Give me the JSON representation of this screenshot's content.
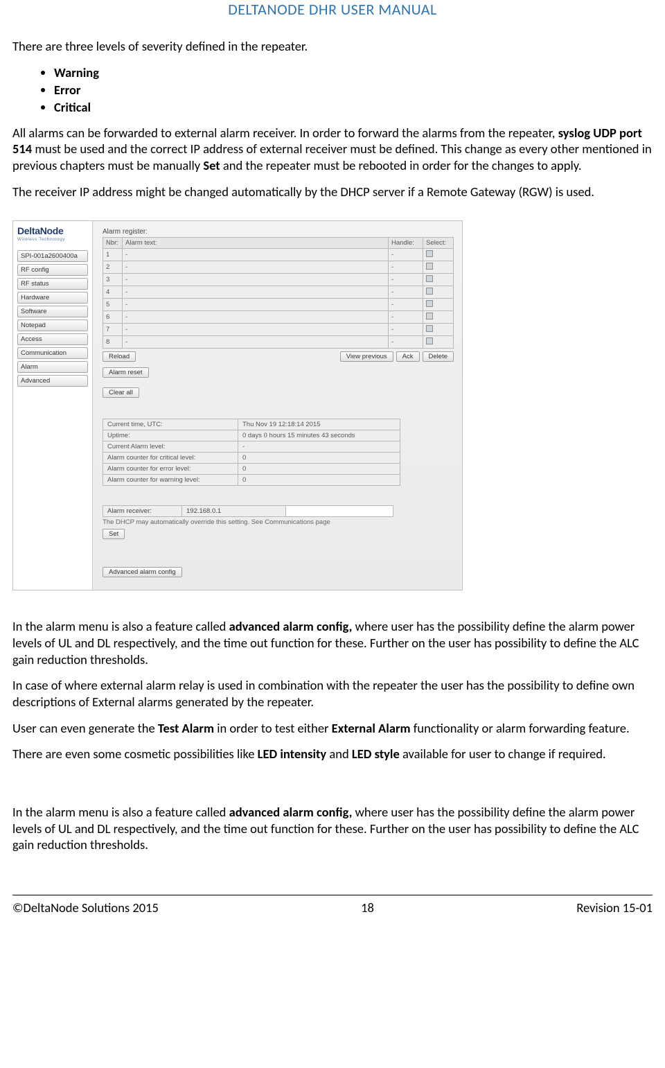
{
  "doc": {
    "title": "DELTANODE DHR USER MANUAL",
    "intro": "There are three levels of severity defined in the repeater.",
    "severities": [
      "Warning",
      "Error",
      "Critical"
    ],
    "p1_a": "All alarms can be forwarded to external alarm receiver. In order to forward the alarms from the repeater, ",
    "p1_bold1": "syslog UDP port 514",
    "p1_b": " must be used and the correct IP address of external receiver must be defined. This change as every other mentioned in previous chapters must be manually ",
    "p1_bold2": "Set",
    "p1_c": " and the repeater must be rebooted in order for the changes to apply.",
    "p2": "The receiver IP address might be changed automatically by the DHCP server if a Remote Gateway (RGW) is used.",
    "p3_a": "In the alarm menu is also a feature called ",
    "p3_bold1": "advanced alarm config,",
    "p3_b": " where user has the possibility define the alarm power levels of UL and DL respectively, and the time out function for these. Further on the user has possibility to define the ALC gain reduction thresholds.",
    "p4": "In case of where external alarm relay is used in combination with the repeater the user has the possibility to define own descriptions of External alarms generated by the repeater.",
    "p5_a": "User can even generate the ",
    "p5_bold1": "Test Alarm",
    "p5_b": " in order to test either ",
    "p5_bold2": "External Alarm",
    "p5_c": " functionality or alarm forwarding feature.",
    "p6_a": "There are even some cosmetic possibilities like ",
    "p6_bold1": "LED intensity",
    "p6_b": " and ",
    "p6_bold2": "LED style",
    "p6_c": " available for user to change if required.",
    "p7_a": "In the alarm menu is also a feature called ",
    "p7_bold1": "advanced alarm config,",
    "p7_b": " where user has the possibility define the alarm power levels of UL and DL respectively, and the time out function for these. Further on the user has possibility to define the ALC gain reduction thresholds.",
    "footer_left": "©DeltaNode Solutions 2015",
    "footer_center": "18",
    "footer_right": "Revision 15-01"
  },
  "app": {
    "logo": "DeltaNode",
    "logo_sub": "Wireless  Technology",
    "nav": [
      "SPI-001a2600400a",
      "RF config",
      "RF status",
      "Hardware",
      "Software",
      "Notepad",
      "Access",
      "Communication",
      "Alarm",
      "Advanced"
    ],
    "reg_title": "Alarm register:",
    "reg_headers": {
      "nbr": "Nbr:",
      "text": "Alarm text:",
      "handle": "Handle:",
      "select": "Select:"
    },
    "reg_rows": [
      {
        "n": "1",
        "t": "-",
        "h": "-"
      },
      {
        "n": "2",
        "t": "-",
        "h": "-"
      },
      {
        "n": "3",
        "t": "-",
        "h": "-"
      },
      {
        "n": "4",
        "t": "-",
        "h": "-"
      },
      {
        "n": "5",
        "t": "-",
        "h": "-"
      },
      {
        "n": "6",
        "t": "-",
        "h": "-"
      },
      {
        "n": "7",
        "t": "-",
        "h": "-"
      },
      {
        "n": "8",
        "t": "-",
        "h": "-"
      }
    ],
    "btn_reload": "Reload",
    "btn_view_prev": "View previous",
    "btn_ack": "Ack",
    "btn_delete": "Delete",
    "btn_alarm_reset": "Alarm reset",
    "btn_clear_all": "Clear all",
    "status": [
      {
        "k": "Current time, UTC:",
        "v": "Thu Nov 19 12:18:14 2015"
      },
      {
        "k": "Uptime:",
        "v": "0 days 0 hours 15 minutes 43 seconds"
      },
      {
        "k": "Current Alarm level:",
        "v": "-"
      },
      {
        "k": "Alarm counter for critical level:",
        "v": "0"
      },
      {
        "k": "Alarm counter for error level:",
        "v": "0"
      },
      {
        "k": "Alarm counter for warning level:",
        "v": "0"
      }
    ],
    "recv_label": "Alarm receiver:",
    "recv_ip": "192.168.0.1",
    "recv_note": "The DHCP may automatically override this setting. See Communications page",
    "btn_set": "Set",
    "btn_adv": "Advanced alarm config"
  }
}
